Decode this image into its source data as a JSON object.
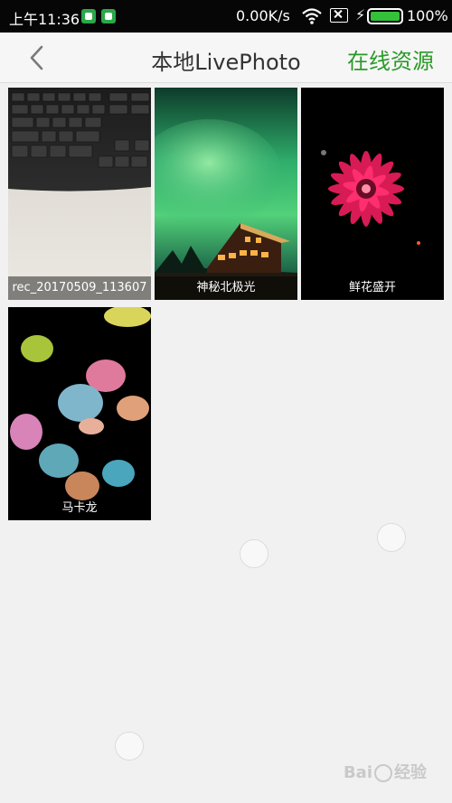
{
  "status_bar": {
    "time": "上午11:36",
    "net_speed": "0.00K/s",
    "battery_pct": "100%",
    "battery_level": 1.0,
    "icons": [
      "notification-book-icon",
      "notification-android-icon",
      "wifi-icon",
      "no-sim-icon",
      "charging-icon",
      "battery-icon"
    ]
  },
  "header": {
    "title": "本地LivePhoto",
    "back_icon": "chevron-left-icon",
    "online_label": "在线资源"
  },
  "colors": {
    "accent": "#2a9a27",
    "battery": "#34c03a",
    "statusbar": "#060606",
    "background": "#f1f1f1"
  },
  "photos": [
    {
      "caption": "rec_20170509_113607"
    },
    {
      "caption": "神秘北极光"
    },
    {
      "caption": "鲜花盛开"
    },
    {
      "caption": "马卡龙"
    }
  ],
  "watermark": {
    "text_a": "Bai",
    "text_b": "经验"
  }
}
